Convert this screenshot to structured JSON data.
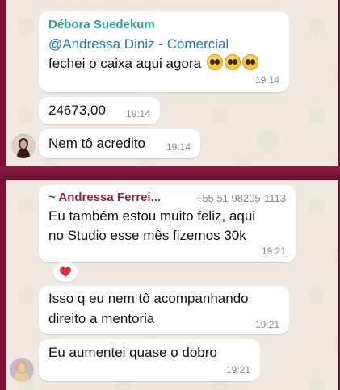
{
  "chat_top": {
    "msg1": {
      "sender": "Débora Suedekum",
      "sender_color": "#2aa198",
      "mention": "@Andressa Diniz - Comercial",
      "text": "fechei o caixa aqui agora",
      "emoji": "pleading-face-icon",
      "time": "19:14"
    },
    "msg2": {
      "text": "24673,00",
      "time": "19:14"
    },
    "msg3": {
      "text": "Nem tô acredito",
      "time": "19:14"
    }
  },
  "chat_bottom": {
    "msg1": {
      "sender": "~ Andressa Ferrei...",
      "phone": "+55 51 98205-1113",
      "sender_color": "#8a2a4a",
      "line1": "Eu também estou muito feliz, aqui",
      "line2": "no Studio esse mês fizemos 30k",
      "time": "19:21",
      "reaction": "heart"
    },
    "msg2": {
      "line1": "Isso q eu nem tô acompanhando",
      "line2": "direito a mentoria",
      "time": "19:21"
    },
    "msg3": {
      "text": "Eu aumentei quase o dobro",
      "time": "19:21"
    }
  }
}
